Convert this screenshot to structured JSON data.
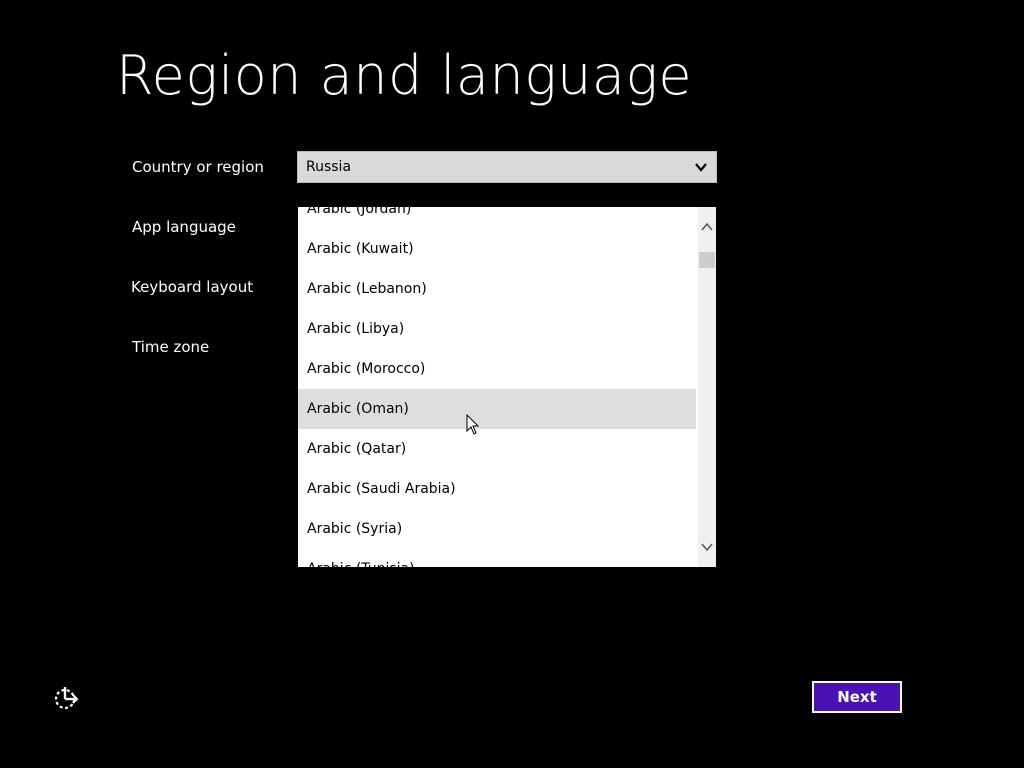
{
  "title": "Region and language",
  "fields": {
    "country_label": "Country or region",
    "app_language_label": "App language",
    "keyboard_layout_label": "Keyboard layout",
    "time_zone_label": "Time zone"
  },
  "country_select": {
    "value": "Russia"
  },
  "dropdown": {
    "items": [
      "Arabic (Jordan)",
      "Arabic (Kuwait)",
      "Arabic (Lebanon)",
      "Arabic (Libya)",
      "Arabic (Morocco)",
      "Arabic (Oman)",
      "Arabic (Qatar)",
      "Arabic (Saudi Arabia)",
      "Arabic (Syria)",
      "Arabic (Tunisia)"
    ],
    "hovered_item": "Arabic (Oman)"
  },
  "buttons": {
    "next_label": "Next"
  },
  "icons": {
    "ease_of_access": "ease-of-access-icon",
    "select_chevron": "chevron-down-icon",
    "scroll_up": "chevron-up-icon",
    "scroll_down": "chevron-down-icon"
  },
  "colors": {
    "background": "#000000",
    "accent": "#4a12b5",
    "dropdown_bg": "#ffffff",
    "hover_bg": "#dedede",
    "select_bg": "#d9d9d9"
  }
}
